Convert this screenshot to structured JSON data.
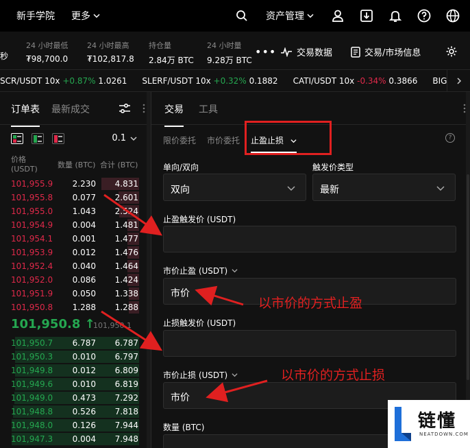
{
  "topnav": {
    "items": [
      "新手学院",
      "更多"
    ],
    "asset_label": "资产管理"
  },
  "stats": {
    "left_fragment": "秒",
    "items": [
      {
        "label": "24 小时最低",
        "value": "₮98,700.0"
      },
      {
        "label": "24 小时最高",
        "value": "₮102,817.8"
      },
      {
        "label": "持仓量",
        "value": "2.84万 BTC"
      },
      {
        "label": "24 小时量",
        "value": "9.28万 BTC"
      }
    ],
    "more": "•••",
    "link_trade_data": "交易数据",
    "link_market_info": "交易/市场信息"
  },
  "marquee": [
    {
      "symbol": "SCR/USDT 10x",
      "change": "+0.87%",
      "price": "1.0261",
      "dir": "pos"
    },
    {
      "symbol": "SLERF/USDT 10x",
      "change": "+0.32%",
      "price": "0.1882",
      "dir": "pos"
    },
    {
      "symbol": "CATI/USDT 10x",
      "change": "-0.34%",
      "price": "0.3866",
      "dir": "neg"
    },
    {
      "symbol": "BIGTIME/U",
      "change": "",
      "price": "",
      "dir": "pos"
    }
  ],
  "orderbook": {
    "tab_active": "订单表",
    "tab_other": "最新成交",
    "step": "0.1",
    "head_price": "价格",
    "head_price_unit": "(USDT)",
    "head_qty": "数量 (BTC)",
    "head_total": "合计 (BTC)",
    "asks": [
      {
        "p": "101,955.9",
        "q": "2.230",
        "t": "4.831",
        "depth": 0.29
      },
      {
        "p": "101,955.8",
        "q": "0.077",
        "t": "2.601",
        "depth": 0.16
      },
      {
        "p": "101,955.0",
        "q": "1.043",
        "t": "2.524",
        "depth": 0.15
      },
      {
        "p": "101,954.9",
        "q": "0.004",
        "t": "1.481",
        "depth": 0.09
      },
      {
        "p": "101,954.1",
        "q": "0.001",
        "t": "1.477",
        "depth": 0.09
      },
      {
        "p": "101,953.9",
        "q": "0.012",
        "t": "1.476",
        "depth": 0.09
      },
      {
        "p": "101,952.4",
        "q": "0.040",
        "t": "1.464",
        "depth": 0.09
      },
      {
        "p": "101,952.0",
        "q": "0.086",
        "t": "1.424",
        "depth": 0.09
      },
      {
        "p": "101,951.9",
        "q": "0.050",
        "t": "1.338",
        "depth": 0.08
      },
      {
        "p": "101,950.8",
        "q": "1.288",
        "t": "1.288",
        "depth": 0.08
      }
    ],
    "last_price": "101,950.8 ↑",
    "mark_price": "101,950.1",
    "bids": [
      {
        "p": "101,950.7",
        "q": "6.787",
        "t": "6.787",
        "depth": 0.95
      },
      {
        "p": "101,950.3",
        "q": "0.010",
        "t": "6.797",
        "depth": 0.95
      },
      {
        "p": "101,949.8",
        "q": "0.012",
        "t": "6.809",
        "depth": 0.95
      },
      {
        "p": "101,949.6",
        "q": "0.010",
        "t": "6.819",
        "depth": 0.95
      },
      {
        "p": "101,949.0",
        "q": "0.473",
        "t": "7.292",
        "depth": 0.96
      },
      {
        "p": "101,948.8",
        "q": "0.526",
        "t": "7.818",
        "depth": 0.97
      },
      {
        "p": "101,948.0",
        "q": "0.126",
        "t": "7.944",
        "depth": 0.98
      },
      {
        "p": "101,947.3",
        "q": "0.004",
        "t": "7.948",
        "depth": 0.98
      }
    ]
  },
  "trade": {
    "tab_active": "交易",
    "tab_other": "工具",
    "order_types": [
      "限价委托",
      "市价委托",
      "止盈止损"
    ],
    "direction_label": "单向/双向",
    "direction_value": "双向",
    "trigger_type_label": "触发价类型",
    "trigger_type_value": "最新",
    "tp_trigger_label": "止盈触发价 (USDT)",
    "tp_market_label": "市价止盈 (USDT)",
    "tp_market_value": "市价",
    "sl_trigger_label": "止损触发价 (USDT)",
    "sl_market_label": "市价止损 (USDT)",
    "sl_market_value": "市价",
    "qty_label": "数量 (BTC)"
  },
  "annotations": {
    "tp_note": "以市价的方式止盈",
    "sl_note": "以市价的方式止损"
  },
  "watermark": {
    "brand": "链懂",
    "site": "NEATDOWN.COM"
  },
  "colors": {
    "up": "#25a750",
    "down": "#e0294a",
    "annotation": "#e02020"
  }
}
